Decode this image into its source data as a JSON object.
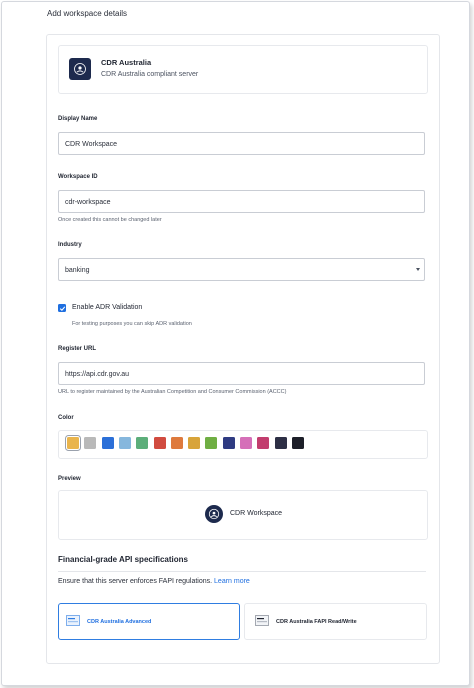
{
  "page": {
    "title": "Add workspace details"
  },
  "server": {
    "name": "CDR Australia",
    "description": "CDR Australia compliant server"
  },
  "form": {
    "display_name": {
      "label": "Display Name",
      "value": "CDR Workspace"
    },
    "workspace_id": {
      "label": "Workspace ID",
      "value": "cdr-workspace",
      "hint": "Once created this cannot be changed later"
    },
    "industry": {
      "label": "Industry",
      "value": "banking"
    },
    "adr_validation": {
      "label": "Enable ADR Validation",
      "checked": true,
      "hint": "For testing purposes you can skip ADR validation"
    },
    "register_url": {
      "label": "Register URL",
      "value": "https://api.cdr.gov.au",
      "hint": "URL to register maintained by the Australian Competition and Consumer Commission (ACCC)"
    },
    "color": {
      "label": "Color",
      "selected_index": 0,
      "swatches": [
        "#e9b44c",
        "#b9b9b9",
        "#2b6fd8",
        "#86b7dd",
        "#5cae7a",
        "#d14b3f",
        "#de7a3d",
        "#d8a43a",
        "#6fae43",
        "#2f3b82",
        "#d56fb8",
        "#c23d6e",
        "#2d2f45",
        "#1d1f29"
      ]
    },
    "preview": {
      "label": "Preview",
      "name": "CDR Workspace"
    }
  },
  "fapi": {
    "title": "Financial-grade API specifications",
    "text": "Ensure that this server enforces FAPI regulations.",
    "link": "Learn more",
    "options": [
      {
        "label": "CDR Australia Advanced",
        "selected": true
      },
      {
        "label": "CDR Australia FAPI Read/Write",
        "selected": false
      }
    ]
  }
}
